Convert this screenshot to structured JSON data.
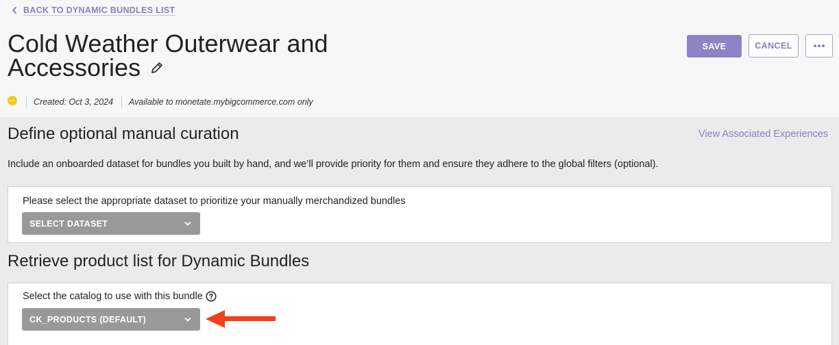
{
  "header": {
    "back_link": "BACK TO DYNAMIC BUNDLES LIST",
    "title_line1": "Cold Weather Outerwear and",
    "title_line2": "Accessories",
    "save_label": "SAVE",
    "cancel_label": "CANCEL",
    "created": "Created: Oct 3, 2024",
    "availability": "Available to monetate.mybigcommerce.com only",
    "status_color": "#f3c81b"
  },
  "manual_curation": {
    "title": "Define optional manual curation",
    "link": "View Associated Experiences",
    "description": "Include an onboarded dataset for bundles you built by hand, and we’ll provide priority for them and ensure they adhere to the global filters (optional).",
    "card_label": "Please select the appropriate dataset to prioritize your manually merchandized bundles",
    "dropdown_value": "SELECT DATASET"
  },
  "product_list": {
    "title": "Retrieve product list for Dynamic Bundles",
    "card_label": "Select the catalog to use with this bundle",
    "dropdown_value": "CK_PRODUCTS (DEFAULT)"
  },
  "colors": {
    "accent": "#8e83c4",
    "dropdown_bg": "#999999",
    "callout_arrow": "#f0401c"
  }
}
